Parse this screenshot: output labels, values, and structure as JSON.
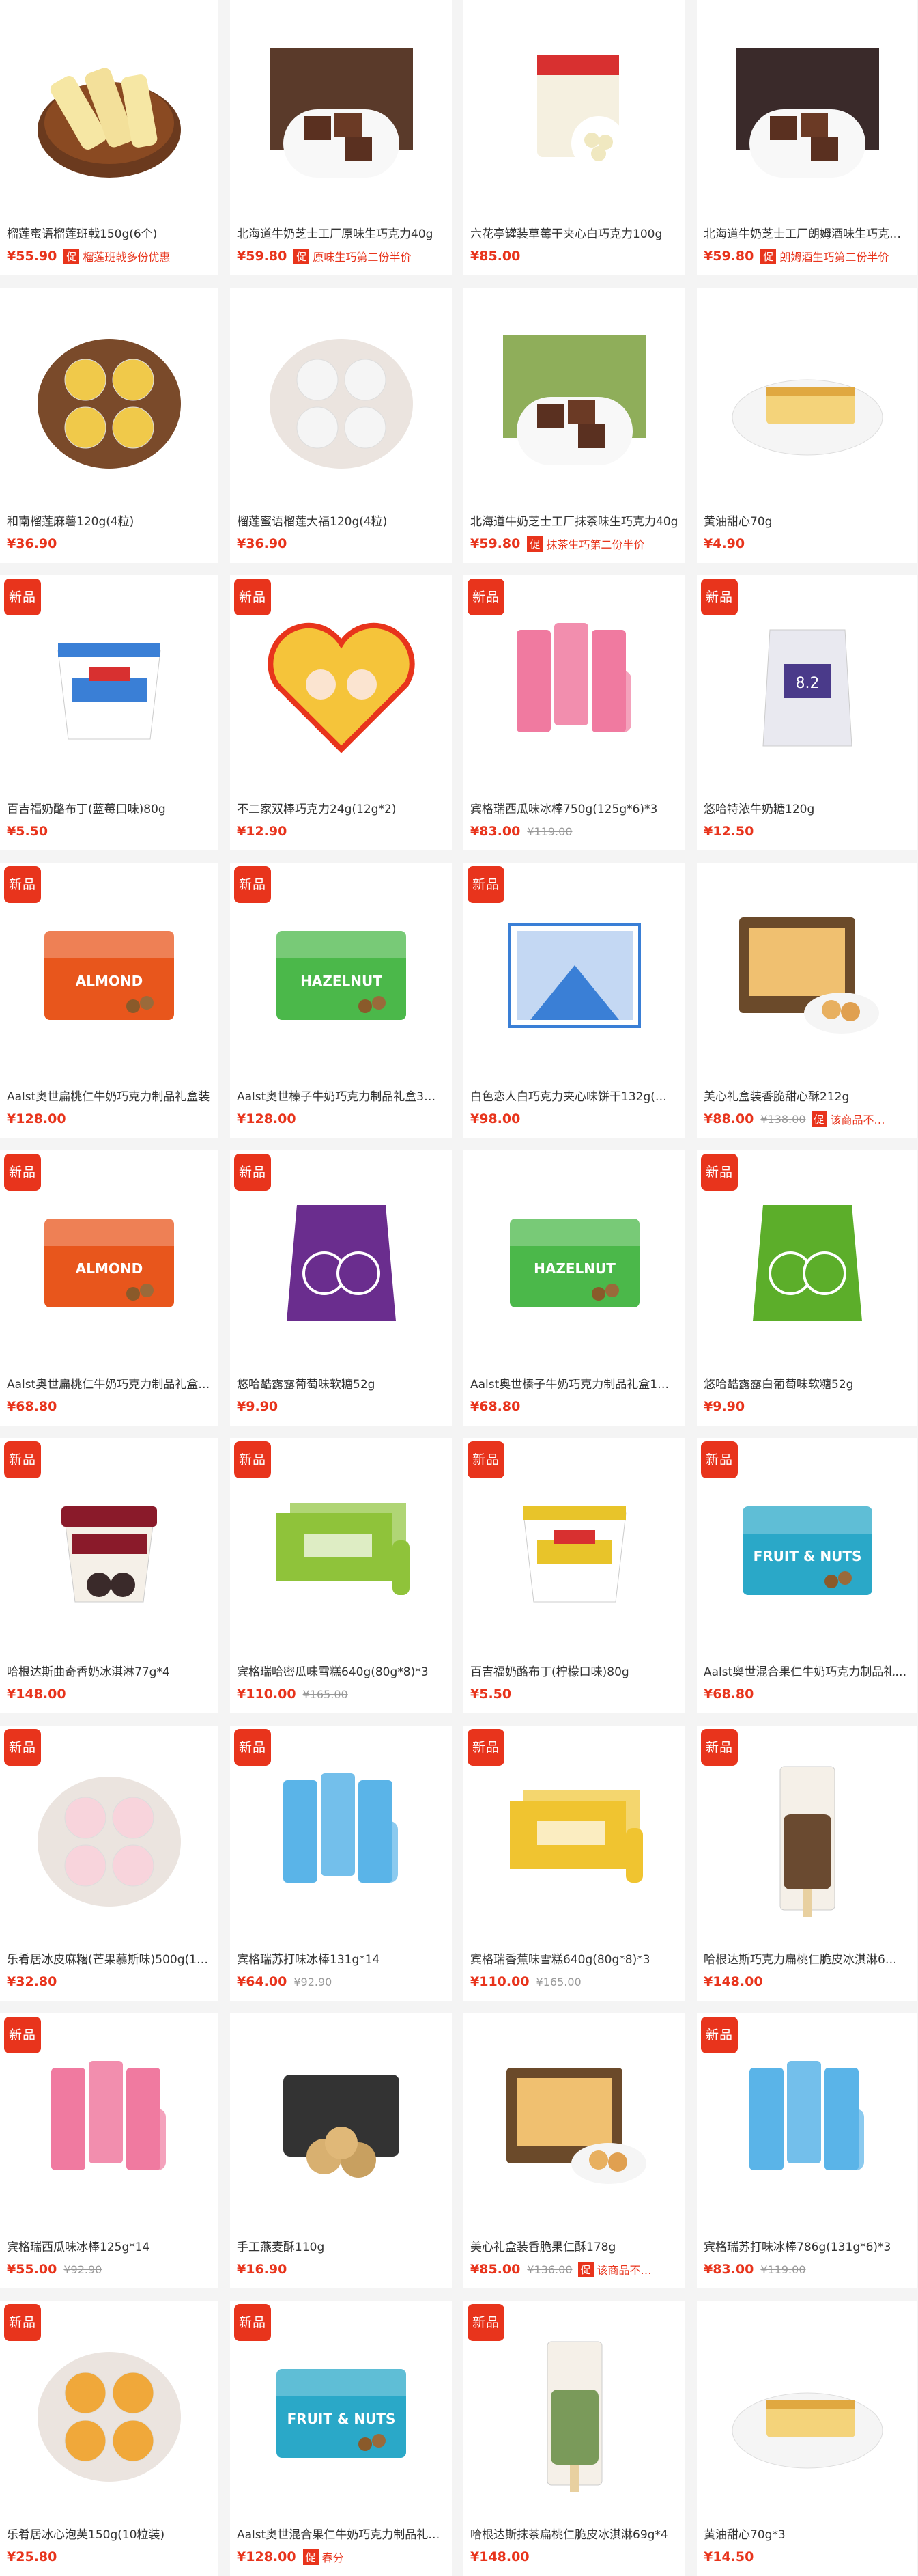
{
  "products": [
    {
      "name": "榴莲蜜语榴莲班戟150g(6个)",
      "price": "¥55.90",
      "promo": "榴莲班戟多份优惠",
      "icon": "durian-crepe-icon",
      "art": "crepe"
    },
    {
      "name": "北海道牛奶芝士工厂原味生巧克力40g",
      "price": "¥59.80",
      "promo": "原味生巧第二份半价",
      "icon": "chocolate-box-icon",
      "art": "choco",
      "artColor": "#5a3a2a"
    },
    {
      "name": "六花亭罐装草莓干夹心白巧克力100g",
      "price": "¥85.00",
      "icon": "candy-jar-icon",
      "art": "jar"
    },
    {
      "name": "北海道牛奶芝士工厂朗姆酒味生巧克力40g",
      "price": "¥59.80",
      "promo": "朗姆酒生巧第二份半价",
      "icon": "chocolate-box-icon",
      "art": "choco",
      "artColor": "#3a2a2a"
    },
    {
      "name": "和南榴莲麻薯120g(4粒)",
      "price": "¥36.90",
      "icon": "mochi-plate-icon",
      "art": "balls",
      "artColor": "#f0c94a"
    },
    {
      "name": "榴莲蜜语榴莲大福120g(4粒)",
      "price": "¥36.90",
      "icon": "daifuku-plate-icon",
      "art": "balls",
      "artColor": "#f5f5f5"
    },
    {
      "name": "北海道牛奶芝士工厂抹茶味生巧克力40g",
      "price": "¥59.80",
      "promo": "抹茶生巧第二份半价",
      "icon": "matcha-chocolate-icon",
      "art": "choco",
      "artColor": "#8fae5a"
    },
    {
      "name": "黄油甜心70g",
      "price": "¥4.90",
      "icon": "butter-cake-icon",
      "art": "cake"
    },
    {
      "name": "百吉福奶酪布丁(蓝莓口味)80g",
      "price": "¥5.50",
      "badge": "新品",
      "icon": "pudding-cup-icon",
      "art": "cup",
      "artColor": "#3a7fd6"
    },
    {
      "name": "不二家双棒巧克力24g(12g*2)",
      "price": "¥12.90",
      "badge": "新品",
      "icon": "heart-candy-icon",
      "art": "heart"
    },
    {
      "name": "宾格瑞西瓜味冰棒750g(125g*6)*3",
      "price": "¥83.00",
      "orig": "¥119.00",
      "badge": "新品",
      "icon": "ice-pop-icon",
      "art": "pops",
      "artColor": "#f07aa0"
    },
    {
      "name": "悠哈特浓牛奶糖120g",
      "price": "¥12.50",
      "badge": "新品",
      "icon": "candy-bag-icon",
      "art": "bag",
      "artColor": "#e9e9f0"
    },
    {
      "name": "Aalst奥世扁桃仁牛奶巧克力制品礼盒装",
      "price": "¥128.00",
      "badge": "新品",
      "icon": "gift-tin-icon",
      "art": "tin",
      "artColor": "#e8561c",
      "artLabel": "ALMOND"
    },
    {
      "name": "Aalst奥世榛子牛奶巧克力制品礼盒3…",
      "price": "¥128.00",
      "badge": "新品",
      "icon": "gift-tin-icon",
      "art": "tin",
      "artColor": "#4bb84a",
      "artLabel": "HAZELNUT"
    },
    {
      "name": "白色恋人白巧克力夹心味饼干132g(…",
      "price": "¥98.00",
      "badge": "新品",
      "icon": "cookie-box-icon",
      "art": "box",
      "artColor": "#3a7fd6"
    },
    {
      "name": "美心礼盒装香脆甜心酥212g",
      "price": "¥88.00",
      "orig": "¥138.00",
      "promo": "该商品不…",
      "icon": "pastry-box-icon",
      "art": "pastry"
    },
    {
      "name": "Aalst奥世扁桃仁牛奶巧克力制品礼盒…",
      "price": "¥68.80",
      "badge": "新品",
      "icon": "gift-tin-icon",
      "art": "tin",
      "artColor": "#e8561c",
      "artLabel": "ALMOND"
    },
    {
      "name": "悠哈酷露露葡萄味软糖52g",
      "price": "¥9.90",
      "badge": "新品",
      "icon": "gummy-bag-icon",
      "art": "gummy",
      "artColor": "#6a2d8e"
    },
    {
      "name": "Aalst奥世榛子牛奶巧克力制品礼盒1…",
      "price": "¥68.80",
      "icon": "gift-tin-icon",
      "art": "tin",
      "artColor": "#4bb84a",
      "artLabel": "HAZELNUT"
    },
    {
      "name": "悠哈酷露露白葡萄味软糖52g",
      "price": "¥9.90",
      "badge": "新品",
      "icon": "gummy-bag-icon",
      "art": "gummy",
      "artColor": "#5cae2a"
    },
    {
      "name": "哈根达斯曲奇香奶冰淇淋77g*4",
      "price": "¥148.00",
      "badge": "新品",
      "icon": "ice-cream-cup-icon",
      "art": "icecream",
      "artColor": "#8a1a2a"
    },
    {
      "name": "宾格瑞哈密瓜味雪糕640g(80g*8)*3",
      "price": "¥110.00",
      "orig": "¥165.00",
      "badge": "新品",
      "icon": "ice-bar-box-icon",
      "art": "melona",
      "artColor": "#8fc33a"
    },
    {
      "name": "百吉福奶酪布丁(柠檬口味)80g",
      "price": "¥5.50",
      "badge": "新品",
      "icon": "pudding-cup-icon",
      "art": "cup",
      "artColor": "#e8c42a"
    },
    {
      "name": "Aalst奥世混合果仁牛奶巧克力制品礼…",
      "price": "¥68.80",
      "badge": "新品",
      "icon": "gift-tin-icon",
      "art": "tin",
      "artColor": "#2aa8c8",
      "artLabel": "FRUIT & NUTS"
    },
    {
      "name": "乐肴居冰皮麻糬(芒果慕斯味)500g(1…",
      "price": "¥32.80",
      "badge": "新品",
      "icon": "mochi-plate-icon",
      "art": "balls",
      "artColor": "#f8d4dc"
    },
    {
      "name": "宾格瑞苏打味冰棒131g*14",
      "price": "¥64.00",
      "orig": "¥92.90",
      "badge": "新品",
      "icon": "ice-pop-icon",
      "art": "pops",
      "artColor": "#5ab4e8"
    },
    {
      "name": "宾格瑞香蕉味雪糕640g(80g*8)*3",
      "price": "¥110.00",
      "orig": "¥165.00",
      "badge": "新品",
      "icon": "ice-bar-box-icon",
      "art": "melona",
      "artColor": "#f0c430"
    },
    {
      "name": "哈根达斯巧克力扁桃仁脆皮冰淇淋6…",
      "price": "¥148.00",
      "badge": "新品",
      "icon": "ice-cream-bar-icon",
      "art": "bar",
      "artColor": "#6a4a30"
    },
    {
      "name": "宾格瑞西瓜味冰棒125g*14",
      "price": "¥55.00",
      "orig": "¥92.90",
      "badge": "新品",
      "icon": "ice-pop-icon",
      "art": "pops",
      "artColor": "#f07aa0"
    },
    {
      "name": "手工燕麦酥110g",
      "price": "¥16.90",
      "icon": "cookie-box-icon",
      "art": "cookies",
      "artColor": "#333333"
    },
    {
      "name": "美心礼盒装香脆果仁酥178g",
      "price": "¥85.00",
      "orig": "¥136.00",
      "promo": "该商品不…",
      "icon": "pastry-box-icon",
      "art": "pastry"
    },
    {
      "name": "宾格瑞苏打味冰棒786g(131g*6)*3",
      "price": "¥83.00",
      "orig": "¥119.00",
      "badge": "新品",
      "icon": "ice-pop-icon",
      "art": "pops",
      "artColor": "#5ab4e8"
    },
    {
      "name": "乐肴居冰心泡芙150g(10粒装)",
      "price": "¥25.80",
      "badge": "新品",
      "icon": "puff-plate-icon",
      "art": "balls",
      "artColor": "#f0a83a"
    },
    {
      "name": "Aalst奥世混合果仁牛奶巧克力制品礼…",
      "price": "¥128.00",
      "promo": "春分",
      "badge": "新品",
      "icon": "gift-tin-icon",
      "art": "tin",
      "artColor": "#2aa8c8",
      "artLabel": "FRUIT & NUTS"
    },
    {
      "name": "哈根达斯抹茶扁桃仁脆皮冰淇淋69g*4",
      "price": "¥148.00",
      "badge": "新品",
      "icon": "ice-cream-bar-icon",
      "art": "bar",
      "artColor": "#7a9a5a"
    },
    {
      "name": "黄油甜心70g*3",
      "price": "¥14.50",
      "icon": "butter-cake-icon",
      "art": "cake"
    }
  ],
  "ui": {
    "promo_tag": "促"
  }
}
